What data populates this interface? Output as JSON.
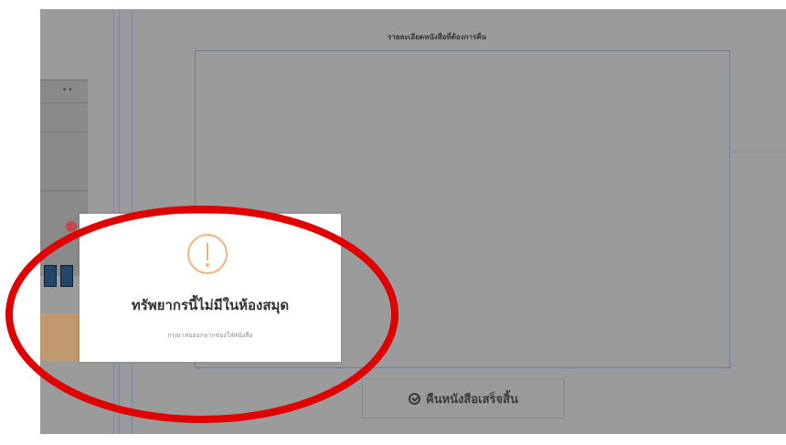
{
  "details": {
    "title": "รายละเอียดหนังสือที่ต้องการคืน"
  },
  "actions": {
    "return_complete_label": "คืนหนังสือเสร็จสิ้น"
  },
  "left_panel": {
    "header_dots": "••"
  },
  "modal": {
    "title": "ทรัพยากรนี้ไม่มีในห้องสมุด",
    "message": "กรุณาลบออกจากช่องใส่หนังสือ",
    "icon": "exclamation-circle-icon",
    "icon_color": "#f0b27f"
  },
  "annotation": {
    "shape": "ellipse",
    "color": "#e00000"
  },
  "colors": {
    "overlay_gray": "#9b9b9b",
    "divider": "#7f8aa2"
  }
}
